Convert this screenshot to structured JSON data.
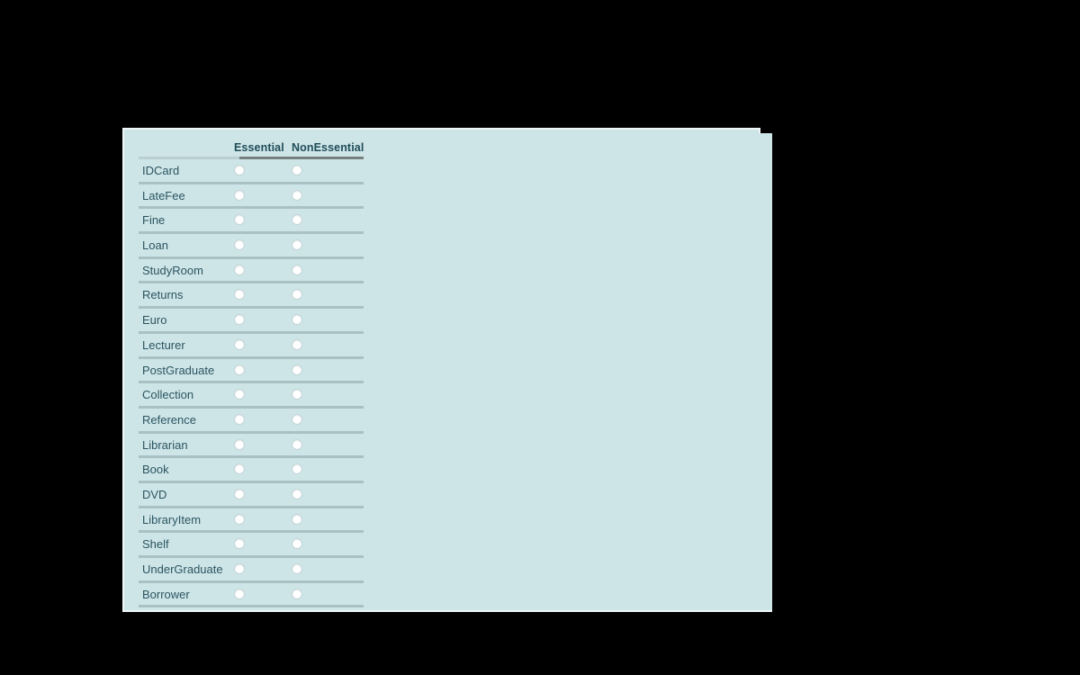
{
  "window": {
    "background_color": "#000000",
    "panel_color": "#cee5e8",
    "panel_edge_color": "#eef6f7",
    "text_color": "#2b5560",
    "header_text_color": "#1f4d58",
    "rule_color": "#a9c1c5",
    "rule_dark_color": "#77807f"
  },
  "table": {
    "name": "essentiality-classification-table",
    "columns": [
      {
        "key": "label",
        "header": ""
      },
      {
        "key": "essential",
        "header": "Essential"
      },
      {
        "key": "nonessential",
        "header": "NonEssential"
      }
    ],
    "header": {
      "essential": "Essential",
      "nonessential": "NonEssential"
    },
    "rows": [
      {
        "label": "IDCard",
        "essential": false,
        "nonessential": false
      },
      {
        "label": "LateFee",
        "essential": false,
        "nonessential": false
      },
      {
        "label": "Fine",
        "essential": false,
        "nonessential": false
      },
      {
        "label": "Loan",
        "essential": false,
        "nonessential": false
      },
      {
        "label": "StudyRoom",
        "essential": false,
        "nonessential": false
      },
      {
        "label": "Returns",
        "essential": false,
        "nonessential": false
      },
      {
        "label": "Euro",
        "essential": false,
        "nonessential": false
      },
      {
        "label": "Lecturer",
        "essential": false,
        "nonessential": false
      },
      {
        "label": "PostGraduate",
        "essential": false,
        "nonessential": false
      },
      {
        "label": "Collection",
        "essential": false,
        "nonessential": false
      },
      {
        "label": "Reference",
        "essential": false,
        "nonessential": false
      },
      {
        "label": "Librarian",
        "essential": false,
        "nonessential": false
      },
      {
        "label": "Book",
        "essential": false,
        "nonessential": false
      },
      {
        "label": "DVD",
        "essential": false,
        "nonessential": false
      },
      {
        "label": "LibraryItem",
        "essential": false,
        "nonessential": false
      },
      {
        "label": "Shelf",
        "essential": false,
        "nonessential": false
      },
      {
        "label": "UnderGraduate",
        "essential": false,
        "nonessential": false
      },
      {
        "label": "Borrower",
        "essential": false,
        "nonessential": false
      }
    ]
  }
}
